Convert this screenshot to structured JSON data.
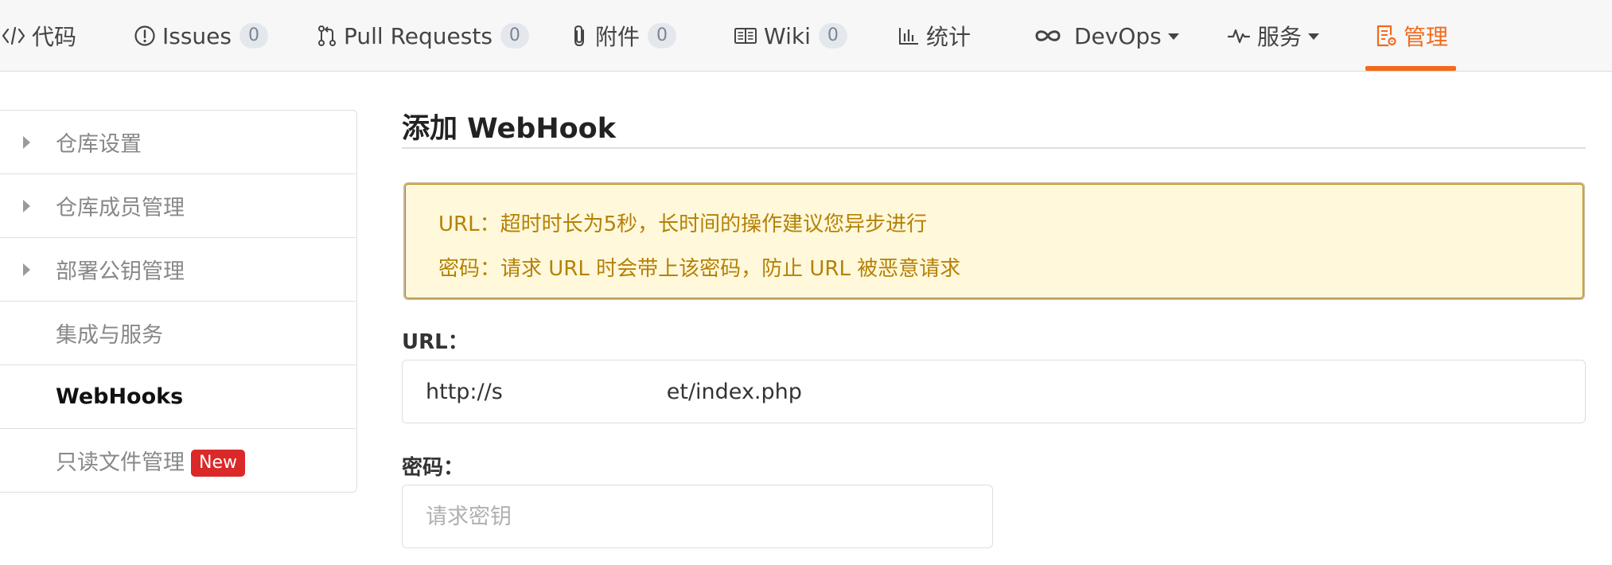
{
  "tabs": [
    {
      "label": "代码",
      "icon": "code-icon"
    },
    {
      "label": "Issues",
      "icon": "issue-icon",
      "count": "0"
    },
    {
      "label": "Pull Requests",
      "icon": "pull-request-icon",
      "count": "0"
    },
    {
      "label": "附件",
      "icon": "paperclip-icon",
      "count": "0"
    },
    {
      "label": "Wiki",
      "icon": "book-icon",
      "count": "0"
    },
    {
      "label": "统计",
      "icon": "bar-chart-icon"
    },
    {
      "label": "DevOps",
      "icon": "infinity-icon"
    },
    {
      "label": "服务",
      "icon": "pulse-icon"
    },
    {
      "label": "管理",
      "icon": "settings-doc-icon",
      "active": true
    }
  ],
  "sidebar": {
    "items": [
      {
        "label": "仓库设置",
        "expandable": true
      },
      {
        "label": "仓库成员管理",
        "expandable": true
      },
      {
        "label": "部署公钥管理",
        "expandable": true
      },
      {
        "label": "集成与服务",
        "expandable": false
      },
      {
        "label": "WebHooks",
        "expandable": false,
        "active": true
      },
      {
        "label": "只读文件管理",
        "expandable": false,
        "badge": "New"
      }
    ]
  },
  "main": {
    "title": "添加 WebHook",
    "notice": {
      "line1": "URL：超时时长为5秒，长时间的操作建议您异步进行",
      "line2": "密码：请求 URL 时会带上该密码，防止 URL 被恶意请求"
    },
    "url_field": {
      "label": "URL：",
      "value": "http://s                        et/index.php"
    },
    "password_field": {
      "label": "密码：",
      "placeholder": "请求密钥",
      "value": ""
    }
  },
  "colors": {
    "accent": "#f36a1d",
    "notice_bg": "#fff8db",
    "notice_text": "#b58105",
    "badge_red": "#db2828"
  }
}
